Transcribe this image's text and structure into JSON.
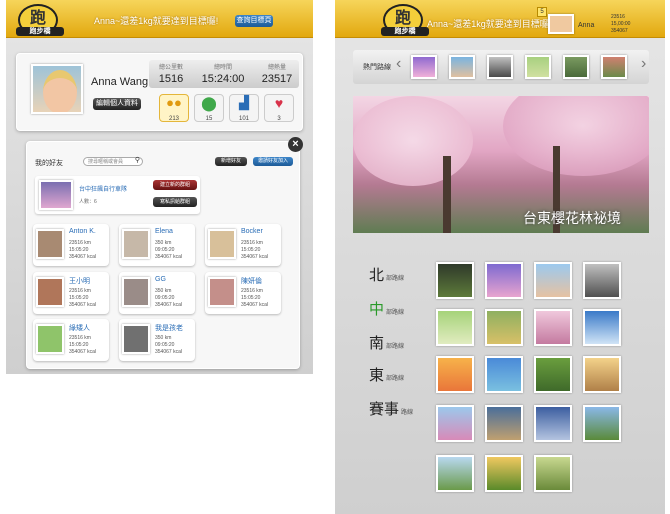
{
  "colors": {
    "accent_yellow": "#e8b21a",
    "link_blue": "#2a6db6",
    "region_active": "#2a9a2a"
  },
  "left": {
    "header": {
      "logo_text": "跑",
      "logo_label": "跑步橋",
      "slogan": "Anna~還差1kg就要達到目標囉!",
      "goal_button": "查詢目標頁"
    },
    "profile": {
      "name": "Anna Wang",
      "edit_button": "編輯個人資料",
      "stats": [
        {
          "label": "總公里數",
          "value": "1516"
        },
        {
          "label": "總時間",
          "value": "15:24:00"
        },
        {
          "label": "總熱量",
          "value": "23517"
        }
      ],
      "badges": [
        {
          "icon": "group-icon",
          "count": "213"
        },
        {
          "icon": "location-icon",
          "count": "15"
        },
        {
          "icon": "run-icon",
          "count": "101"
        },
        {
          "icon": "heart-icon",
          "count": "3"
        }
      ]
    },
    "friends": {
      "title": "我的好友",
      "search_placeholder": "搜尋暱稱或會員",
      "add_button": "新增好友",
      "invite_button": "邀請好友加入",
      "group": {
        "name": "台中狂飆自行車隊",
        "meta": "人數：6",
        "btn_create": "建立新的群組",
        "btn_message": "寫私訊給群組"
      },
      "list": [
        {
          "name": "Anton K.",
          "stats": [
            "23516 km",
            "15:05:20",
            "354067 kcal"
          ]
        },
        {
          "name": "Elena",
          "stats": [
            "350 km",
            "09:05:20",
            "354067 kcal"
          ]
        },
        {
          "name": "Bocker",
          "stats": [
            "23516 km",
            "15:05:20",
            "354067 kcal"
          ]
        },
        {
          "name": "王小明",
          "stats": [
            "23516 km",
            "15:05:20",
            "354067 kcal"
          ]
        },
        {
          "name": "GG",
          "stats": [
            "350 km",
            "09:05:20",
            "354067 kcal"
          ]
        },
        {
          "name": "陳妍倫",
          "stats": [
            "23516 km",
            "15:05:20",
            "354067 kcal"
          ]
        },
        {
          "name": "綠矮人",
          "stats": [
            "23516 km",
            "15:05:20",
            "354067 kcal"
          ]
        },
        {
          "name": "我是孩老",
          "stats": [
            "350 km",
            "09:05:20",
            "354067 kcal"
          ]
        }
      ]
    }
  },
  "right": {
    "header": {
      "slogan": "Anna~還差1kg就要達到目標囉!",
      "badge": "5",
      "user": "Anna",
      "user_stats": [
        "23516",
        "15,00:00",
        "354067"
      ]
    },
    "popular": {
      "title": "熱門路線"
    },
    "hero": {
      "caption": "台東櫻花林祕境"
    },
    "regions": [
      {
        "name": "北",
        "suffix": "部路線"
      },
      {
        "name": "中",
        "suffix": "部路線"
      },
      {
        "name": "南",
        "suffix": "部路線"
      },
      {
        "name": "東",
        "suffix": "部路線"
      },
      {
        "name": "賽事",
        "suffix": "路線"
      }
    ]
  }
}
